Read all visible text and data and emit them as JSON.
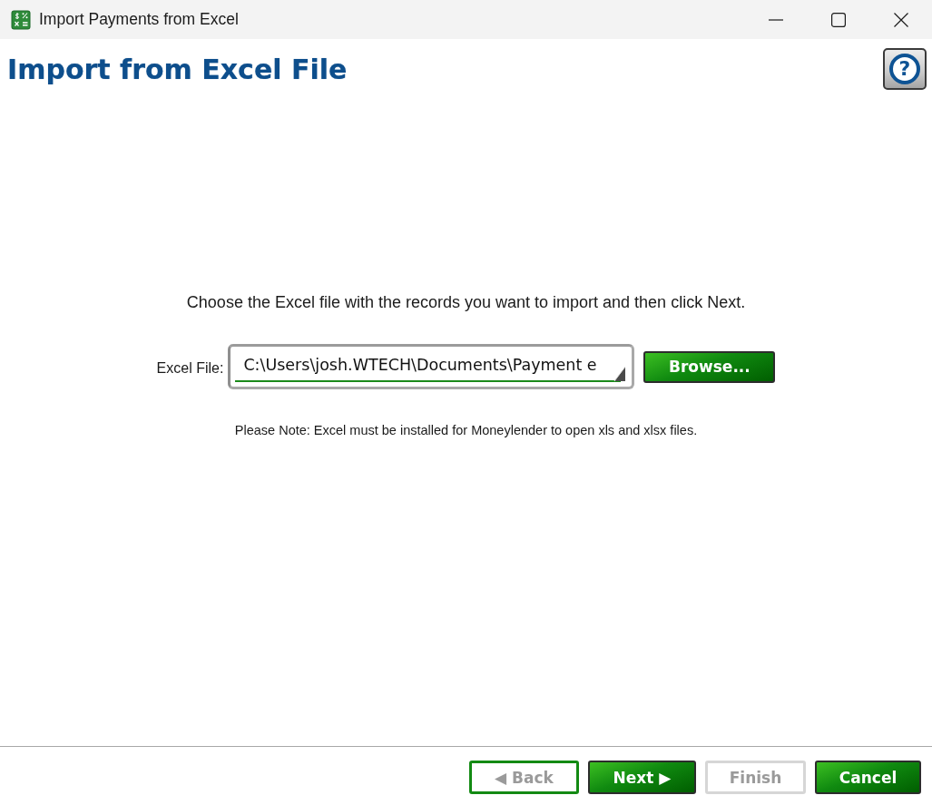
{
  "window": {
    "title": "Import Payments from Excel"
  },
  "header": {
    "title": "Import from Excel File",
    "help_button": {
      "label": "?"
    }
  },
  "instructions": "Choose the Excel file with the records you want to import and then click Next.",
  "file_field": {
    "label": "Excel File:",
    "value": "C:\\Users\\josh.WTECH\\Documents\\Payment e"
  },
  "browse_button": {
    "label": "Browse...",
    "disabled": false,
    "focused": false
  },
  "note": "Please Note: Excel must be installed for Moneylender to open xls and xlsx files.",
  "buttons": [
    {
      "label": "◀ Back",
      "disabled": true,
      "focused": true
    },
    {
      "label": "Next ▶",
      "disabled": false,
      "focused": false
    },
    {
      "label": "Finish",
      "disabled": true,
      "focused": false
    },
    {
      "label": "Cancel",
      "disabled": false,
      "focused": false
    }
  ]
}
